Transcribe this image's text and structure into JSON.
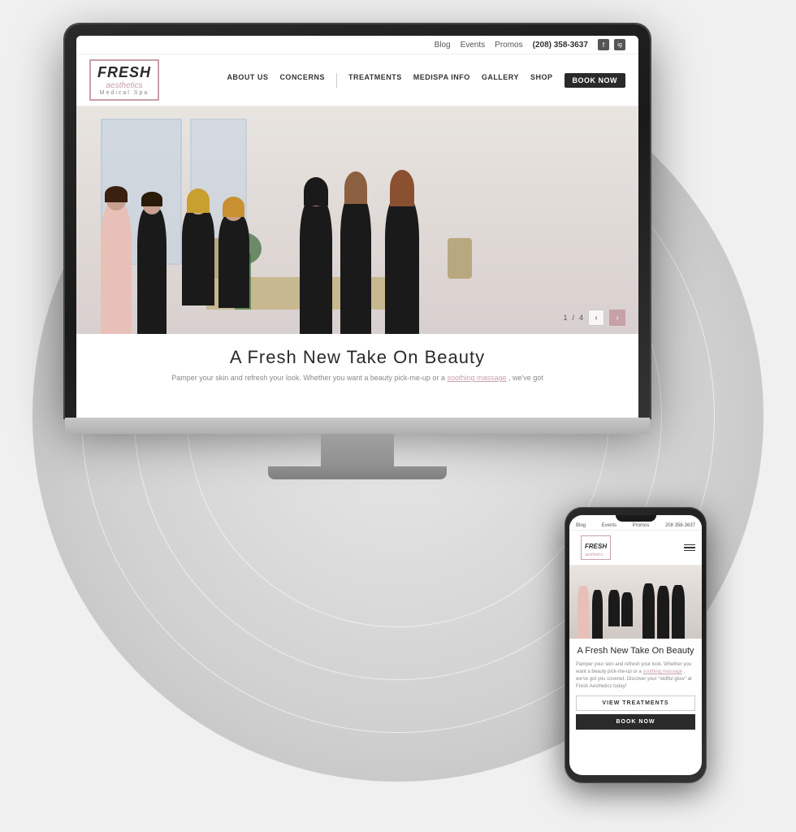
{
  "scene": {
    "bg_color": "#e0e0e0"
  },
  "website": {
    "topbar": {
      "blog": "Blog",
      "events": "Events",
      "promos": "Promos",
      "phone": "(208) 358-3637",
      "social_fb": "f",
      "social_ig": "ig"
    },
    "navbar": {
      "logo_fresh": "FRESH",
      "logo_script": "aesthetics",
      "logo_sub": "Medical Spa",
      "nav_items": [
        "ABOUT US",
        "CONCERNS",
        "TREATMENTS",
        "MEDISPA INFO",
        "GALLERY",
        "SHOP"
      ],
      "book_now": "BOOK NOW"
    },
    "hero": {
      "slide_current": "1",
      "slide_total": "4",
      "slide_separator": "/"
    },
    "tagline": {
      "heading": "A Fresh New Take On Beauty",
      "body_text": "Pamper your skin and refresh your look. Whether you want a beauty pick-me-up or a",
      "link_text": "soothing massage",
      "body_text2": ", we've got"
    }
  },
  "mobile": {
    "topbar": {
      "blog": "Blog",
      "events": "Events",
      "promos": "Promos",
      "phone": "208 358-3637"
    },
    "logo_fresh": "FRESH",
    "logo_script": "aesthetics",
    "tagline": {
      "heading": "A Fresh New Take On Beauty",
      "body_text": "Pamper your skin and refresh your look. Whether you want a beauty pick-me-up or a",
      "link_text": "soothing massage",
      "body_text2": ", we've got you covered. Discover your \"skillful glow\" at Fresh Aesthetics today!"
    },
    "btn_treatments": "VIEW TREATMENTS",
    "btn_book": "BOOK NOW"
  }
}
